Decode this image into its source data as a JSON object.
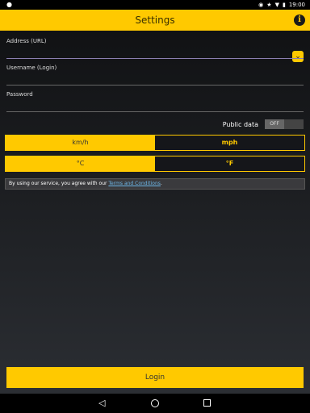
{
  "status_bar": {
    "clock": "19:00",
    "icons": [
      "location-icon",
      "star-icon",
      "wifi-icon",
      "battery-icon"
    ]
  },
  "app_bar": {
    "title": "Settings",
    "info_icon_glyph": "i"
  },
  "form": {
    "address_label": "Address (URL)",
    "address_value": "",
    "username_label": "Username (Login)",
    "username_value": "",
    "password_label": "Password",
    "password_value": "",
    "dropdown_glyph": "⌄"
  },
  "public_data": {
    "label": "Public data",
    "toggle_state": "OFF"
  },
  "speed_units": {
    "options": [
      "km/h",
      "mph"
    ],
    "selected": "km/h"
  },
  "temp_units": {
    "options": [
      "°C",
      "°F"
    ],
    "selected": "°C"
  },
  "terms": {
    "prefix": "By using our service, you agree with our ",
    "link": "Terms and Conditions",
    "suffix": "."
  },
  "login_label": "Login",
  "colors": {
    "accent": "#ffc900",
    "link": "#6db7e8"
  }
}
